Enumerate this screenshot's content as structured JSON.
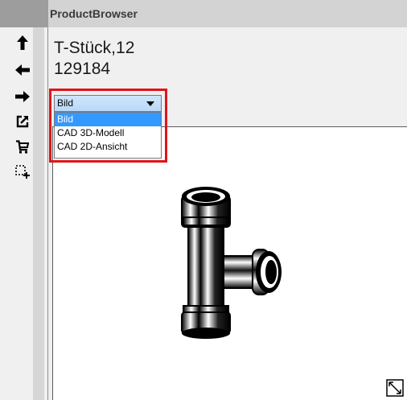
{
  "window": {
    "title": "ProductBrowser"
  },
  "toolbar": {
    "buttons": [
      {
        "icon": "arrow-up-icon",
        "glyph": "🠉"
      },
      {
        "icon": "arrow-left-icon",
        "glyph": "🠈"
      },
      {
        "icon": "arrow-right-icon",
        "glyph": "🠊"
      },
      {
        "icon": "open-external-icon"
      },
      {
        "icon": "cart-icon"
      },
      {
        "icon": "add-selection-icon"
      }
    ]
  },
  "product": {
    "name": "T-Stück,12",
    "number": "129184"
  },
  "view_select": {
    "value": "Bild",
    "options": [
      "Bild",
      "CAD 3D-Modell",
      "CAD 2D-Ansicht"
    ],
    "selected_index": 0
  },
  "colors": {
    "highlight": "#e0141b",
    "selection": "#3399ff"
  }
}
